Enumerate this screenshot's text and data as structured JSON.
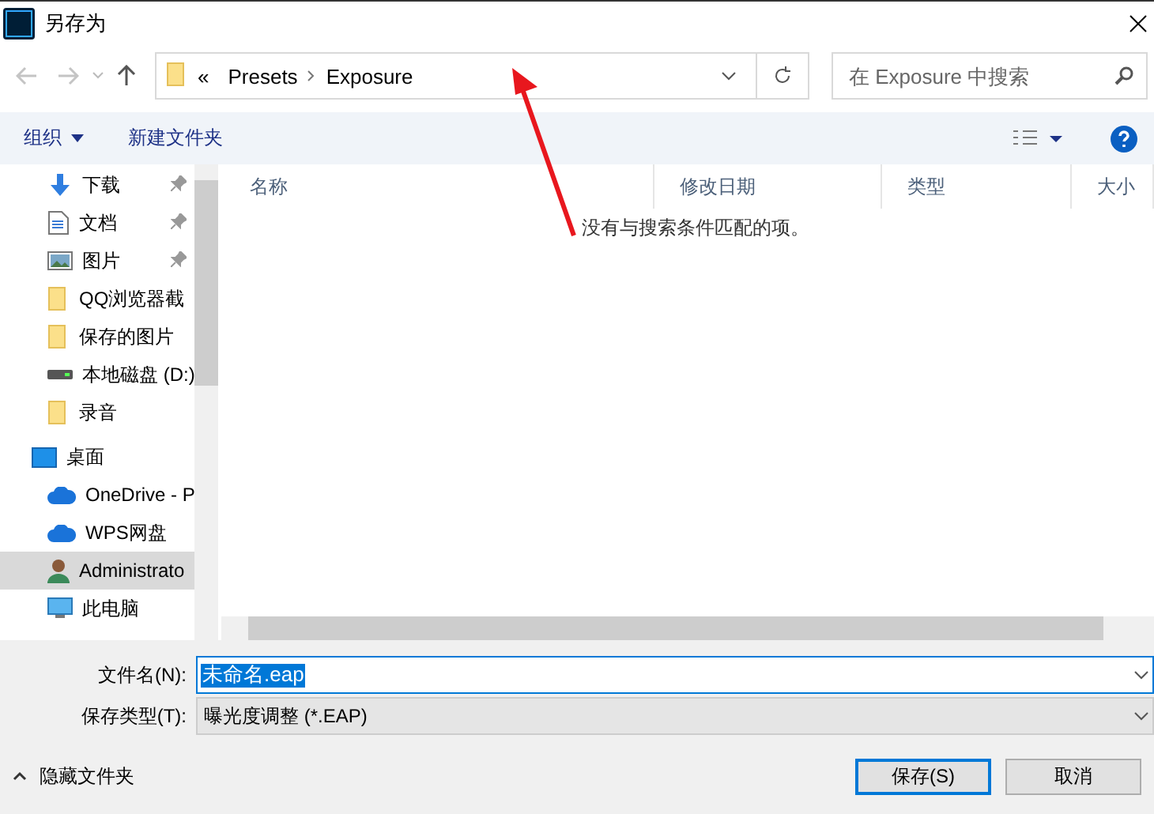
{
  "window": {
    "title": "另存为"
  },
  "nav": {
    "breadcrumb": [
      "Presets",
      "Exposure"
    ],
    "overflow": "«",
    "search": {
      "placeholder": "在 Exposure 中搜索"
    }
  },
  "toolbar": {
    "organize": "组织",
    "new_folder": "新建文件夹"
  },
  "sidebar": {
    "quick_access": [
      {
        "label": "下载",
        "kind": "download",
        "pinned": true,
        "selected": false
      },
      {
        "label": "文档",
        "kind": "document",
        "pinned": true,
        "selected": false
      },
      {
        "label": "图片",
        "kind": "picture",
        "pinned": true,
        "selected": false
      },
      {
        "label": "QQ浏览器截",
        "kind": "folder",
        "pinned": false,
        "selected": false
      },
      {
        "label": "保存的图片",
        "kind": "folder",
        "pinned": false,
        "selected": false
      },
      {
        "label": "本地磁盘 (D:)",
        "kind": "drive",
        "pinned": false,
        "selected": false
      },
      {
        "label": "录音",
        "kind": "folder",
        "pinned": false,
        "selected": false
      }
    ],
    "tree": [
      {
        "label": "桌面",
        "kind": "desktop",
        "selected": false,
        "children": [
          {
            "label": "OneDrive - P",
            "kind": "cloud",
            "selected": false
          },
          {
            "label": "WPS网盘",
            "kind": "cloud",
            "selected": false
          },
          {
            "label": "Administrato",
            "kind": "user",
            "selected": true
          },
          {
            "label": "此电脑",
            "kind": "computer",
            "selected": false
          }
        ]
      }
    ]
  },
  "table": {
    "columns": [
      "名称",
      "修改日期",
      "类型",
      "大小"
    ],
    "empty_message": "没有与搜索条件匹配的项。"
  },
  "form": {
    "file_name": {
      "label": "文件名(N):",
      "value": "未命名.eap"
    },
    "file_type": {
      "label": "保存类型(T):",
      "value": "曝光度调整 (*.EAP)"
    }
  },
  "footer": {
    "hide_folders": "隐藏文件夹",
    "buttons": [
      {
        "label": "保存(S)",
        "kind": "primary"
      },
      {
        "label": "取消",
        "kind": "normal"
      }
    ]
  }
}
